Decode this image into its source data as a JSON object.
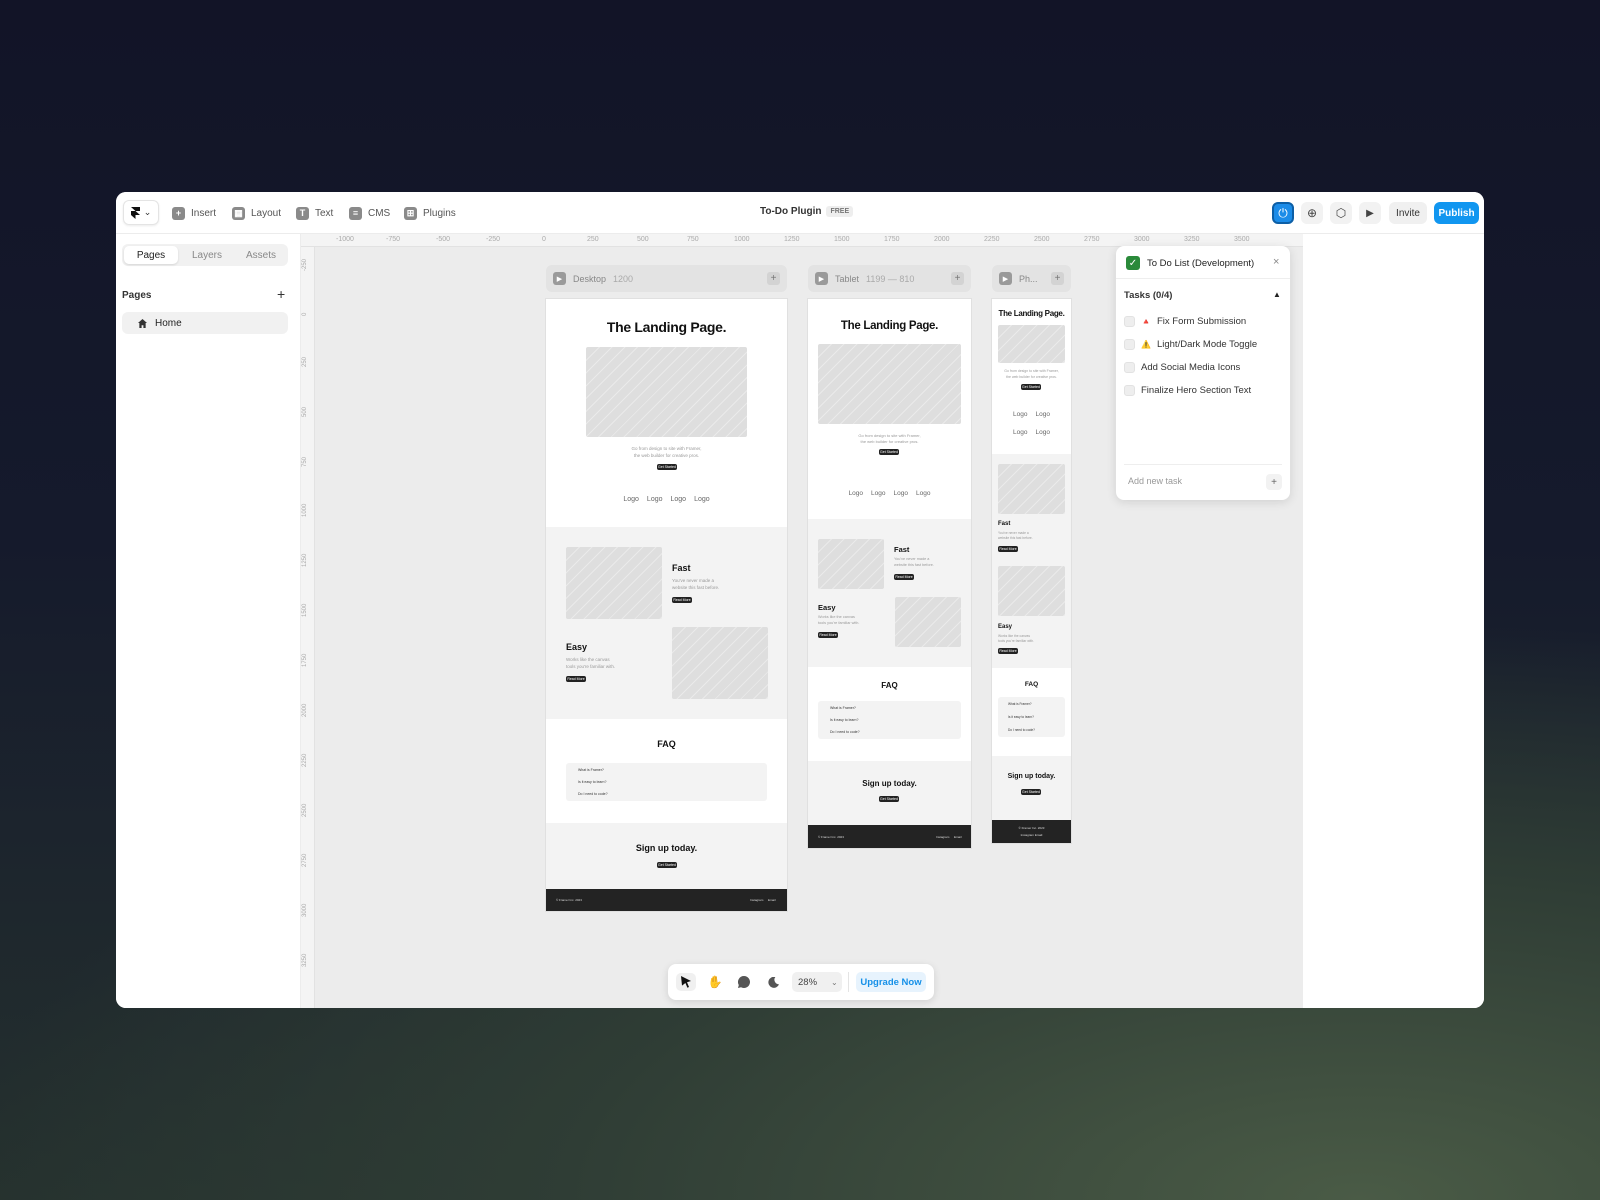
{
  "toolbar": {
    "logo_caret": "⌄",
    "insert": "Insert",
    "layout": "Layout",
    "text": "Text",
    "cms": "CMS",
    "plugins": "Plugins",
    "title": "To-Do Plugin",
    "badge": "FREE",
    "invite": "Invite",
    "publish": "Publish",
    "power_glyph": "⏻",
    "globe_glyph": "⊕",
    "settings_glyph": "⬡",
    "play_glyph": "▶"
  },
  "sidebar": {
    "tabs": [
      "Pages",
      "Layers",
      "Assets"
    ],
    "section_label": "Pages",
    "add_glyph": "+",
    "pages": [
      {
        "label": "Home",
        "icon": "home-icon"
      }
    ]
  },
  "rulers": {
    "x": [
      "-1000",
      "-750",
      "-500",
      "-250",
      "0",
      "250",
      "500",
      "750",
      "1000",
      "1250",
      "1500",
      "1750",
      "2000",
      "2250",
      "2500",
      "2750",
      "3000",
      "3250",
      "3500"
    ],
    "y": [
      "-250",
      "0",
      "250",
      "500",
      "750",
      "1000",
      "1250",
      "1500",
      "1750",
      "2000",
      "2250",
      "2500",
      "2750",
      "3000",
      "3250"
    ]
  },
  "frames": {
    "desktop": {
      "name": "Desktop",
      "size": "1200"
    },
    "tablet": {
      "name": "Tablet",
      "size": "1199 — 810"
    },
    "phone": {
      "name": "Ph..."
    }
  },
  "landing": {
    "title": "The Landing Page.",
    "subtitle_line1": "Go from design to site with Framer,",
    "subtitle_line2": "the web builder for creative pros.",
    "cta": "Get Started",
    "logo_label": "Logo",
    "feature1_title": "Fast",
    "feature1_desc_line1": "You've never made a",
    "feature1_desc_line2": "website this fast before.",
    "feature2_title": "Easy",
    "feature2_desc_line1": "Works like the canvas",
    "feature2_desc_line2": "tools you're familiar with.",
    "read_more": "Read More",
    "faq_title": "FAQ",
    "faq": [
      "What is Framer?",
      "Is it easy to learn?",
      "Do I need to code?"
    ],
    "signup": "Sign up today.",
    "footer_copy": "© Framer Inc. 2023",
    "footer_link1": "Instagram",
    "footer_link2": "Email"
  },
  "todo": {
    "title": "To Do List (Development)",
    "close": "×",
    "tasks_label": "Tasks (0/4)",
    "collapse_glyph": "▲",
    "tasks": [
      {
        "label": "Fix Form Submission",
        "priority": "🔺",
        "done": false
      },
      {
        "label": "Light/Dark Mode Toggle",
        "priority": "⚠️",
        "done": false
      },
      {
        "label": "Add Social Media Icons",
        "priority": "",
        "done": false
      },
      {
        "label": "Finalize Hero Section Text",
        "priority": "",
        "done": false
      }
    ],
    "add_placeholder": "Add new task",
    "add_glyph": "+"
  },
  "bottom": {
    "zoom": "28%",
    "upgrade": "Upgrade Now"
  },
  "colors": {
    "accent": "#1196f0",
    "todo_check": "#2a8a3a"
  }
}
